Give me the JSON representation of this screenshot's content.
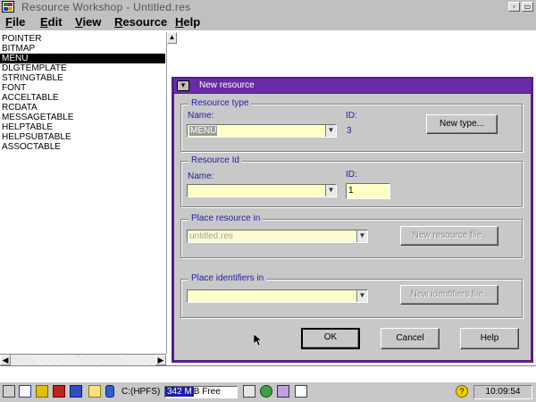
{
  "window": {
    "title": "Resource Workshop - Untitled.res",
    "minimize_glyph": "▫",
    "maximize_glyph": "▭"
  },
  "menubar": {
    "items": [
      {
        "label": "File",
        "mnemonic": "F"
      },
      {
        "label": "Edit",
        "mnemonic": "E"
      },
      {
        "label": "View",
        "mnemonic": "V"
      },
      {
        "label": "Resource",
        "mnemonic": "R"
      },
      {
        "label": "Help",
        "mnemonic": "H"
      }
    ]
  },
  "resource_list": {
    "items": [
      "POINTER",
      "BITMAP",
      "MENU",
      "DLGTEMPLATE",
      "STRINGTABLE",
      "FONT",
      "ACCELTABLE",
      "RCDATA",
      "MESSAGETABLE",
      "HELPTABLE",
      "HELPSUBTABLE",
      "ASSOCTABLE"
    ],
    "selected": "MENU"
  },
  "dialog": {
    "title": "New resource",
    "resource_type": {
      "group_label": "Resource type",
      "name_label": "Name:",
      "name_value": "MENU",
      "id_label": "ID:",
      "id_value": "3",
      "new_type_button": "New type..."
    },
    "resource_id": {
      "group_label": "Resource Id",
      "name_label": "Name:",
      "name_value": "",
      "id_label": "ID:",
      "id_value": "1"
    },
    "place_resource": {
      "group_label": "Place resource in",
      "value": "untitled.res",
      "button": "New resource file.."
    },
    "place_identifiers": {
      "group_label": "Place identifiers in",
      "value": "",
      "button": "New identifiers file.."
    },
    "buttons": {
      "ok": "OK",
      "cancel": "Cancel",
      "help": "Help"
    }
  },
  "taskbar": {
    "drive": "C:(HPFS)",
    "free_value": "342 M",
    "free_suffix": "B Free",
    "clock": "10:09:54"
  },
  "colors": {
    "dialog_frame": "#5a1a8c",
    "dialog_title": "#6b2aa8",
    "field_bg": "#ffffc8",
    "selection": "#000000"
  }
}
